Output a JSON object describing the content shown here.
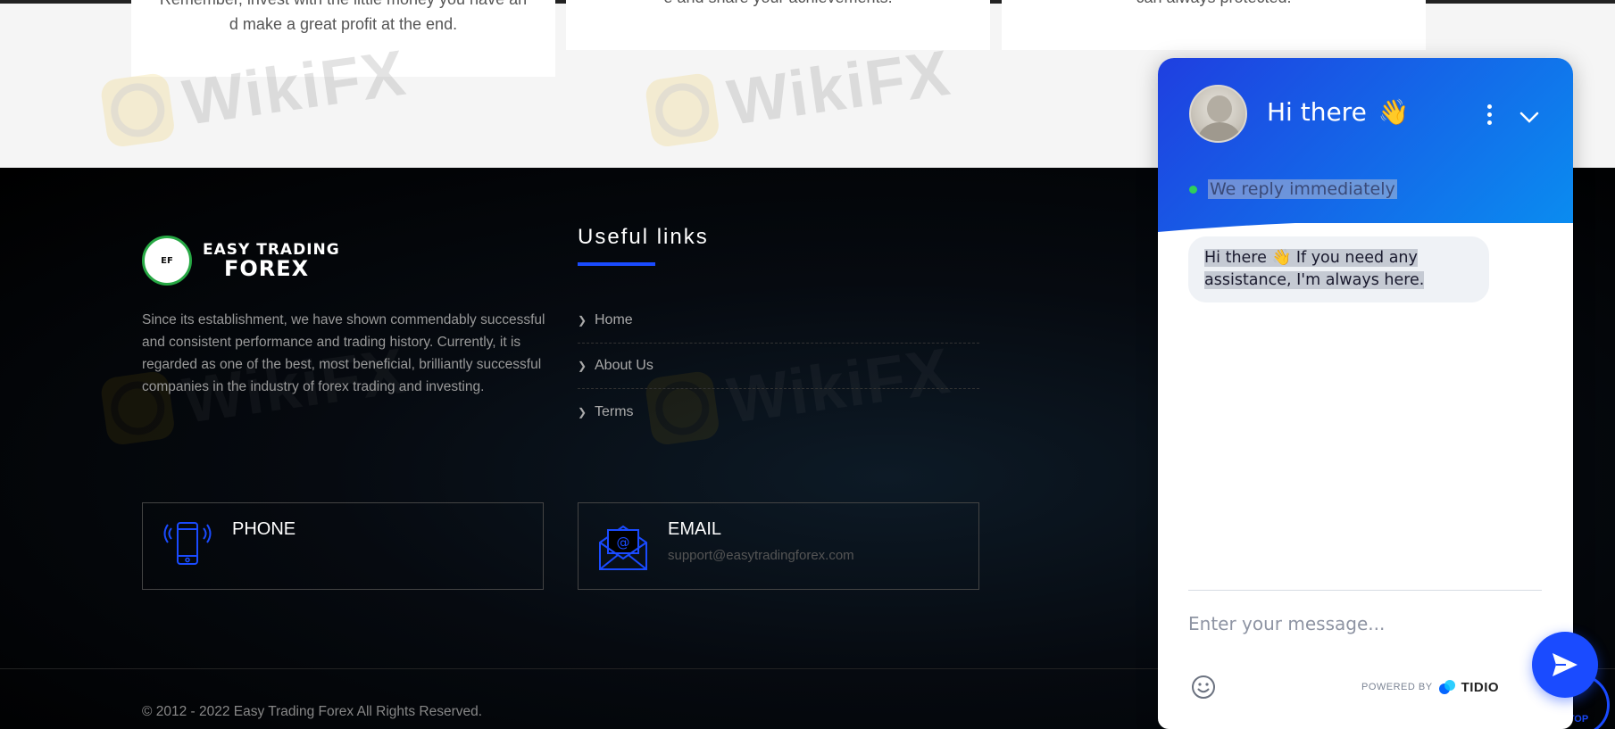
{
  "cards": {
    "card1": {
      "line_a": "Remember, invest with the little money you have an",
      "line_b": "d make a great profit at the end."
    },
    "card2": {
      "line_a": "e and share your achievements."
    },
    "card3": {
      "line_a": "can always protected."
    }
  },
  "watermark": {
    "text": "WikiFX"
  },
  "footer": {
    "logo": {
      "badge": "EF",
      "line1": "EASY TRADING",
      "line2": "FOREX"
    },
    "about": "Since its establishment, we have shown commendably successful and consistent performance and trading history. Currently, it is regarded as one of the best, most beneficial, brilliantly successful companies in the industry of forex trading and investing.",
    "useful_links": {
      "title": "Useful links",
      "items": [
        {
          "label": "Home"
        },
        {
          "label": "About Us"
        },
        {
          "label": "Terms"
        }
      ]
    },
    "contacts": {
      "phone": {
        "title": "PHONE",
        "value": ""
      },
      "email": {
        "title": "EMAIL",
        "value": "support@easytradingforex.com"
      }
    },
    "copyright": "© 2012 - 2022 Easy Trading Forex All Rights Reserved.",
    "top_button": "TOP"
  },
  "chat": {
    "title": "Hi there",
    "title_emoji": "👋",
    "status": "We reply immediately",
    "status_color": "#2fce5a",
    "message": {
      "part1": "Hi there ",
      "emoji": "👋",
      "part2": " If you need any assistance, I'm always here."
    },
    "input_placeholder": "Enter your message...",
    "powered_by": "POWERED BY",
    "brand": "TIDIO",
    "accent": "#1a4bff"
  }
}
